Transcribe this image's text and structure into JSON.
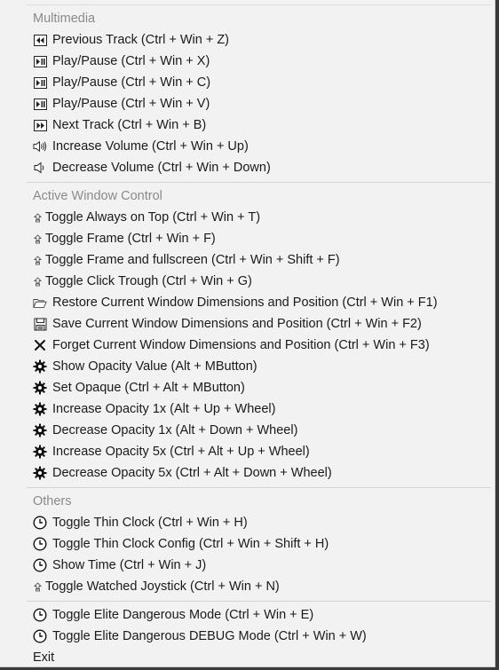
{
  "sections": {
    "multimedia": {
      "title": "Multimedia",
      "items": [
        {
          "label": "Previous Track (Ctrl + Win + Z)",
          "icon": "previous-track-icon"
        },
        {
          "label": "Play/Pause (Ctrl + Win + X)",
          "icon": "play-pause-icon"
        },
        {
          "label": "Play/Pause (Ctrl + Win + C)",
          "icon": "play-pause-icon"
        },
        {
          "label": "Play/Pause (Ctrl + Win + V)",
          "icon": "play-pause-icon"
        },
        {
          "label": "Next Track (Ctrl + Win + B)",
          "icon": "next-track-icon"
        },
        {
          "label": "Increase Volume (Ctrl + Win + Up)",
          "icon": "volume-up-icon"
        },
        {
          "label": "Decrease Volume (Ctrl + Win + Down)",
          "icon": "volume-down-icon"
        }
      ]
    },
    "active_window": {
      "title": "Active Window Control",
      "items": [
        {
          "label": "Toggle Always on Top (Ctrl + Win + T)",
          "icon": "window-toggle-icon"
        },
        {
          "label": "Toggle Frame (Ctrl + Win + F)",
          "icon": "window-toggle-icon"
        },
        {
          "label": "Toggle Frame and fullscreen (Ctrl + Win + Shift + F)",
          "icon": "window-toggle-icon"
        },
        {
          "label": "Toggle Click Trough (Ctrl + Win + G)",
          "icon": "window-toggle-icon"
        },
        {
          "label": "Restore Current Window Dimensions and Position (Ctrl + Win + F1)",
          "icon": "folder-icon"
        },
        {
          "label": "Save Current Window Dimensions and Position (Ctrl + Win + F2)",
          "icon": "save-icon"
        },
        {
          "label": "Forget Current Window Dimensions and Position (Ctrl + Win + F3)",
          "icon": "close-icon"
        },
        {
          "label": "Show Opacity Value (Alt + MButton)",
          "icon": "gear-icon"
        },
        {
          "label": "Set Opaque (Ctrl + Alt + MButton)",
          "icon": "gear-icon"
        },
        {
          "label": "Increase Opacity 1x (Alt + Up + Wheel)",
          "icon": "gear-icon"
        },
        {
          "label": "Decrease Opacity 1x (Alt + Down + Wheel)",
          "icon": "gear-icon"
        },
        {
          "label": "Increase Opacity 5x (Ctrl + Alt + Up + Wheel)",
          "icon": "gear-icon"
        },
        {
          "label": "Decrease Opacity 5x (Ctrl + Alt + Down + Wheel)",
          "icon": "gear-icon"
        }
      ]
    },
    "others": {
      "title": "Others",
      "items": [
        {
          "label": "Toggle Thin Clock (Ctrl + Win + H)",
          "icon": "clock-icon"
        },
        {
          "label": "Toggle Thin Clock Config (Ctrl + Win + Shift + H)",
          "icon": "clock-icon"
        },
        {
          "label": "Show Time (Ctrl + Win + J)",
          "icon": "clock-icon"
        },
        {
          "label": "Toggle Watched Joystick (Ctrl + Win + N)",
          "icon": "window-toggle-icon"
        }
      ]
    },
    "elite": {
      "items": [
        {
          "label": "Toggle Elite Dangerous Mode (Ctrl + Win + E)",
          "icon": "clock-icon"
        },
        {
          "label": "Toggle Elite Dangerous DEBUG Mode (Ctrl + Win + W)",
          "icon": "clock-icon"
        }
      ]
    },
    "exit": {
      "label": "Exit"
    }
  }
}
